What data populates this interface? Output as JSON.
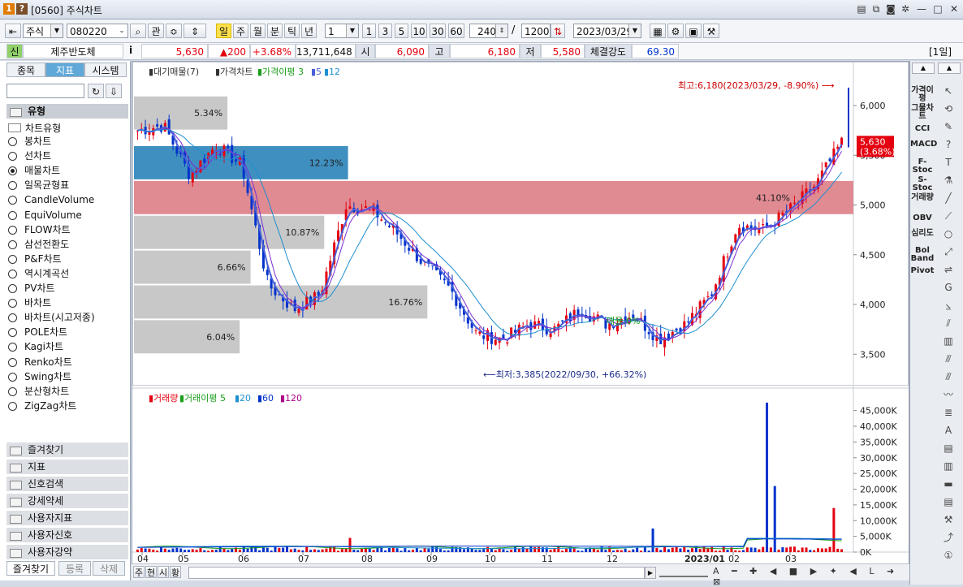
{
  "window": {
    "badge1": "1",
    "badge2": "?",
    "title": "[0560] 주식차트"
  },
  "toolbar": {
    "market": "주식",
    "code": "080220",
    "lookup_label": "관",
    "periods": [
      "일",
      "주",
      "월",
      "분",
      "틱",
      "년"
    ],
    "active_period": "일",
    "interval_value": "1",
    "intervals": [
      "1",
      "3",
      "5",
      "10",
      "30",
      "60"
    ],
    "display_count": "240",
    "total_count": "1200",
    "date": "2023/03/29"
  },
  "quote": {
    "badge": "신",
    "name": "제주반도체",
    "info_icon": "i",
    "price": "5,630",
    "change": "▲200",
    "change_pct": "+3.68%",
    "volume": "13,711,648",
    "open_label": "시",
    "open": "6,090",
    "high_label": "고",
    "high": "6,180",
    "low_label": "저",
    "low": "5,580",
    "strength_label": "체결강도",
    "strength": "69.30",
    "period_tag": "[1일]"
  },
  "left_panel": {
    "tabs": [
      "종목",
      "지표",
      "시스템"
    ],
    "active_tab": "지표",
    "category": "유형",
    "tree_root": "차트유형",
    "chart_types": [
      "봉차트",
      "선차트",
      "매물차트",
      "일목균형표",
      "CandleVolume",
      "EquiVolume",
      "FLOW차트",
      "삼선전환도",
      "P&F차트",
      "역시계곡선",
      "PV차트",
      "바차트",
      "바차트(시고저종)",
      "POLE차트",
      "Kagi차트",
      "Renko차트",
      "Swing차트",
      "분산형차트",
      "ZigZag차트"
    ],
    "selected_type": "매물차트",
    "folders": [
      "즐겨찾기",
      "지표",
      "신호검색",
      "강세약세",
      "사용자지표",
      "사용자신호",
      "사용자강약"
    ],
    "bottom_tabs": [
      "즐겨찾기",
      "등록",
      "삭제"
    ]
  },
  "right_panel": {
    "indicators": [
      "가격이평",
      "그물차트",
      "CCI",
      "MACD",
      "F-Stoc",
      "S-Stoc",
      "거래량",
      "OBV",
      "심리도",
      "Bol Band",
      "Pivot"
    ]
  },
  "bottom_bar": {
    "buttons": [
      "주",
      "현",
      "시",
      "황"
    ]
  },
  "colors": {
    "up": "#e4000f",
    "down": "#0033cc",
    "ma_price_short": "#4a5fd8",
    "ma_price_long": "#1e8fd0",
    "profile_gray": "#c8c8c8",
    "profile_blue": "#3f8fc0",
    "profile_red": "#e08a92"
  },
  "chart_data": [
    {
      "type": "candlestick",
      "title": "가격차트",
      "legend": [
        "대기매물(7)",
        "가격차트",
        "가격이평 3",
        "5",
        "12"
      ],
      "x_tick_labels": [
        "04",
        "05",
        "06",
        "07",
        "08",
        "09",
        "10",
        "11",
        "12",
        "2023/01",
        "02",
        "03"
      ],
      "ylim": [
        3200,
        6400
      ],
      "y_ticks": [
        "3,500",
        "4,000",
        "4,500",
        "5,000",
        "5,500",
        "6,000"
      ],
      "x": [
        "2022/04",
        "2022/05",
        "2022/06",
        "2022/07",
        "2022/08",
        "2022/09",
        "2022/10",
        "2022/11",
        "2022/12",
        "2023/01",
        "2023/02",
        "2023/03"
      ],
      "close_approx": [
        5750,
        5300,
        5500,
        3900,
        5000,
        4500,
        3600,
        3800,
        3850,
        3700,
        4300,
        5630
      ],
      "supply_profile": [
        {
          "low": 5750,
          "high": 6100,
          "pct": "5.34%"
        },
        {
          "low": 5250,
          "high": 5600,
          "pct": "12.23%"
        },
        {
          "low": 4900,
          "high": 5250,
          "pct": "41.10%"
        },
        {
          "low": 4550,
          "high": 4900,
          "pct": "10.87%"
        },
        {
          "low": 4200,
          "high": 4550,
          "pct": "6.66%"
        },
        {
          "low": 3850,
          "high": 4200,
          "pct": "16.76%"
        },
        {
          "low": 3500,
          "high": 3850,
          "pct": "6.04%"
        }
      ],
      "annotations": {
        "max": "최고:6,180(2023/03/29, -8.90%)",
        "min": "최저:3,385(2022/09/30, +66.32%)",
        "current_price": "5,630",
        "current_pct": "(3.68%)",
        "ma_label": "매물:0%"
      }
    },
    {
      "type": "bar",
      "title": "거래량",
      "legend": [
        "거래량",
        "거래이평 5",
        "20",
        "60",
        "120"
      ],
      "ylim": [
        0,
        48000
      ],
      "y_ticks": [
        "0K",
        "5,000K",
        "10,000K",
        "15,000K",
        "20,000K",
        "25,000K",
        "30,000K",
        "35,000K",
        "40,000K",
        "45,000K"
      ],
      "peaks": [
        {
          "x": "2022/07",
          "value": 4500
        },
        {
          "x": "2022/12",
          "value": 7500
        },
        {
          "x": "2023/02",
          "value": 47500
        },
        {
          "x": "2023/02",
          "value": 21000
        },
        {
          "x": "2023/03",
          "value": 14000
        }
      ]
    }
  ]
}
